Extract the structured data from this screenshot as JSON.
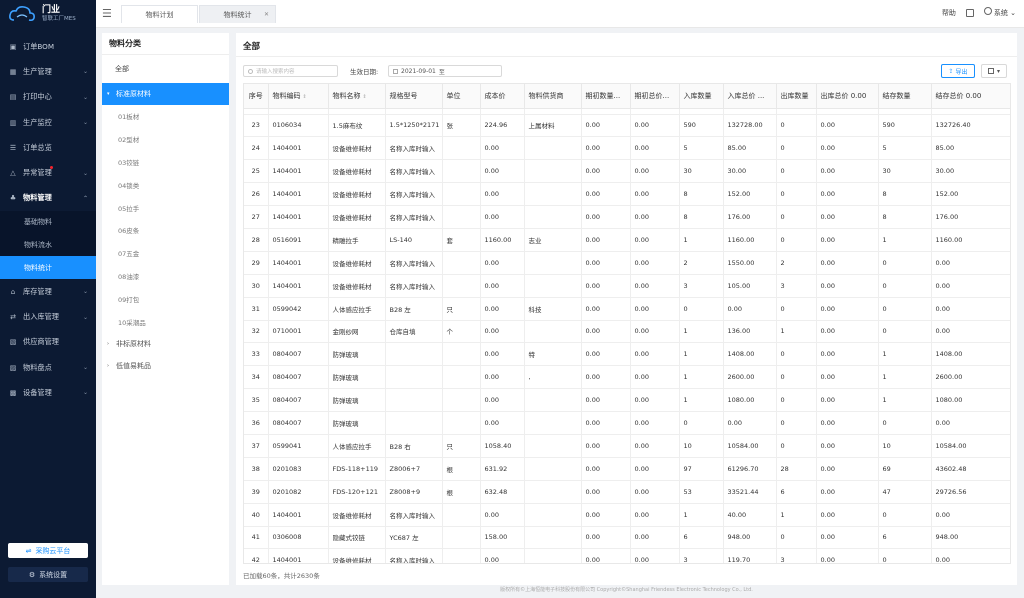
{
  "brand": {
    "name": "门业",
    "subtitle": "智联工厂MES"
  },
  "sidebar": {
    "items": [
      {
        "label": "订单BOM",
        "icon": "folder-icon"
      },
      {
        "label": "生产管理",
        "icon": "factory-icon"
      },
      {
        "label": "打印中心",
        "icon": "printer-icon"
      },
      {
        "label": "生产监控",
        "icon": "monitor-icon"
      },
      {
        "label": "订单总览",
        "icon": "list-icon"
      },
      {
        "label": "异常管理",
        "icon": "warning-icon"
      },
      {
        "label": "物料管理",
        "icon": "materials-icon"
      }
    ],
    "sub_items": [
      {
        "label": "基础物料"
      },
      {
        "label": "物料流水"
      },
      {
        "label": "物料统计"
      }
    ],
    "items_after": [
      {
        "label": "库存管理",
        "icon": "warehouse-icon"
      },
      {
        "label": "出入库管理",
        "icon": "inout-icon"
      },
      {
        "label": "供应商管理",
        "icon": "supplier-icon"
      },
      {
        "label": "物料盘点",
        "icon": "inventory-icon"
      },
      {
        "label": "设备管理",
        "icon": "device-icon"
      }
    ],
    "cloud_button": "采购云平台",
    "settings_button": "系统设置"
  },
  "header": {
    "tabs": [
      {
        "label": "物料计划"
      },
      {
        "label": "物料统计"
      }
    ],
    "help": "帮助",
    "user": "系统"
  },
  "category": {
    "title": "物料分类",
    "all_label": "全部",
    "groups": [
      {
        "label": "标准原材料",
        "expanded": true,
        "children": [
          "01板材",
          "02型材",
          "03铰链",
          "04锁类",
          "05拉手",
          "06皮条",
          "07五金",
          "08油漆",
          "09打包",
          "10采潮品"
        ]
      },
      {
        "label": "非标原材料",
        "expanded": false
      },
      {
        "label": "低值易耗品",
        "expanded": false
      }
    ]
  },
  "main": {
    "title": "全部",
    "search_placeholder": "请输入搜索内容",
    "date_label": "生效日期:",
    "date_start": "2021-09-01",
    "date_sep": "至",
    "export_label": "导出",
    "columns": [
      "序号",
      "物料编码",
      "物料名称",
      "规格型号",
      "单位",
      "成本价",
      "物料供货商",
      "期初数量...",
      "期初总价...",
      "入库数量",
      "入库总价 ...",
      "出库数量",
      "出库总价 0.00",
      "结存数量",
      "结存总价 0.00"
    ],
    "rows": [
      [
        "23",
        "0106034",
        "1.5麻布纹",
        "1.5*1250*2171",
        "张",
        "224.96",
        "上属材料",
        "0.00",
        "0.00",
        "590",
        "132728.00",
        "0",
        "0.00",
        "590",
        "132726.40"
      ],
      [
        "24",
        "1404001",
        "设备维修耗材",
        "名称入库时输入",
        "",
        "0.00",
        "",
        "0.00",
        "0.00",
        "5",
        "85.00",
        "0",
        "0.00",
        "5",
        "85.00"
      ],
      [
        "25",
        "1404001",
        "设备维修耗材",
        "名称入库时输入",
        "",
        "0.00",
        "",
        "0.00",
        "0.00",
        "30",
        "30.00",
        "0",
        "0.00",
        "30",
        "30.00"
      ],
      [
        "26",
        "1404001",
        "设备维修耗材",
        "名称入库时输入",
        "",
        "0.00",
        "",
        "0.00",
        "0.00",
        "8",
        "152.00",
        "0",
        "0.00",
        "8",
        "152.00"
      ],
      [
        "27",
        "1404001",
        "设备维修耗材",
        "名称入库时输入",
        "",
        "0.00",
        "",
        "0.00",
        "0.00",
        "8",
        "176.00",
        "0",
        "0.00",
        "8",
        "176.00"
      ],
      [
        "28",
        "0516091",
        "精雕拉手",
        "LS-140",
        "套",
        "1160.00",
        "志业",
        "0.00",
        "0.00",
        "1",
        "1160.00",
        "0",
        "0.00",
        "1",
        "1160.00"
      ],
      [
        "29",
        "1404001",
        "设备维修耗材",
        "名称入库时输入",
        "",
        "0.00",
        "",
        "0.00",
        "0.00",
        "2",
        "1550.00",
        "2",
        "0.00",
        "0",
        "0.00"
      ],
      [
        "30",
        "1404001",
        "设备维修耗材",
        "名称入库时输入",
        "",
        "0.00",
        "",
        "0.00",
        "0.00",
        "3",
        "105.00",
        "3",
        "0.00",
        "0",
        "0.00"
      ],
      [
        "31",
        "0599042",
        "人体感应拉手",
        "B28 左",
        "只",
        "0.00",
        "科技",
        "0.00",
        "0.00",
        "0",
        "0.00",
        "0",
        "0.00",
        "0",
        "0.00"
      ],
      [
        "32",
        "0710001",
        "金刚纱网",
        "仓库自填",
        "个",
        "0.00",
        "",
        "0.00",
        "0.00",
        "1",
        "136.00",
        "1",
        "0.00",
        "0",
        "0.00"
      ],
      [
        "33",
        "0804007",
        "防弹玻璃",
        "",
        "",
        "0.00",
        "特",
        "0.00",
        "0.00",
        "1",
        "1408.00",
        "0",
        "0.00",
        "1",
        "1408.00"
      ],
      [
        "34",
        "0804007",
        "防弹玻璃",
        "",
        "",
        "0.00",
        ",",
        "0.00",
        "0.00",
        "1",
        "2600.00",
        "0",
        "0.00",
        "1",
        "2600.00"
      ],
      [
        "35",
        "0804007",
        "防弹玻璃",
        "",
        "",
        "0.00",
        "",
        "0.00",
        "0.00",
        "1",
        "1080.00",
        "0",
        "0.00",
        "1",
        "1080.00"
      ],
      [
        "36",
        "0804007",
        "防弹玻璃",
        "",
        "",
        "0.00",
        "",
        "0.00",
        "0.00",
        "0",
        "0.00",
        "0",
        "0.00",
        "0",
        "0.00"
      ],
      [
        "37",
        "0599041",
        "人体感应拉手",
        "B28 右",
        "只",
        "1058.40",
        "",
        "0.00",
        "0.00",
        "10",
        "10584.00",
        "0",
        "0.00",
        "10",
        "10584.00"
      ],
      [
        "38",
        "0201083",
        "FDS-118+119",
        "Z8006+7",
        "根",
        "631.92",
        "",
        "0.00",
        "0.00",
        "97",
        "61296.70",
        "28",
        "0.00",
        "69",
        "43602.48"
      ],
      [
        "39",
        "0201082",
        "FDS-120+121",
        "Z8008+9",
        "根",
        "632.48",
        "",
        "0.00",
        "0.00",
        "53",
        "33521.44",
        "6",
        "0.00",
        "47",
        "29726.56"
      ],
      [
        "40",
        "1404001",
        "设备维修耗材",
        "名称入库时输入",
        "",
        "0.00",
        "",
        "0.00",
        "0.00",
        "1",
        "40.00",
        "1",
        "0.00",
        "0",
        "0.00"
      ],
      [
        "41",
        "0306008",
        "隐藏式铰链",
        "YC687 左",
        "",
        "158.00",
        "",
        "0.00",
        "0.00",
        "6",
        "948.00",
        "0",
        "0.00",
        "6",
        "948.00"
      ],
      [
        "42",
        "1404001",
        "设备维修耗材",
        "名称入库时输入",
        "",
        "0.00",
        "",
        "0.00",
        "0.00",
        "3",
        "119.70",
        "3",
        "0.00",
        "0",
        "0.00"
      ]
    ],
    "footer": "已加载60条，共计2630条"
  },
  "copyright": "版权所有©上海恒能电子科技股份有限公司 Copyright©Shanghai Friendess Electronic Technology Co., Ltd.",
  "colors": {
    "sidebar_bg": "#0c1a33",
    "accent": "#1890ff"
  }
}
